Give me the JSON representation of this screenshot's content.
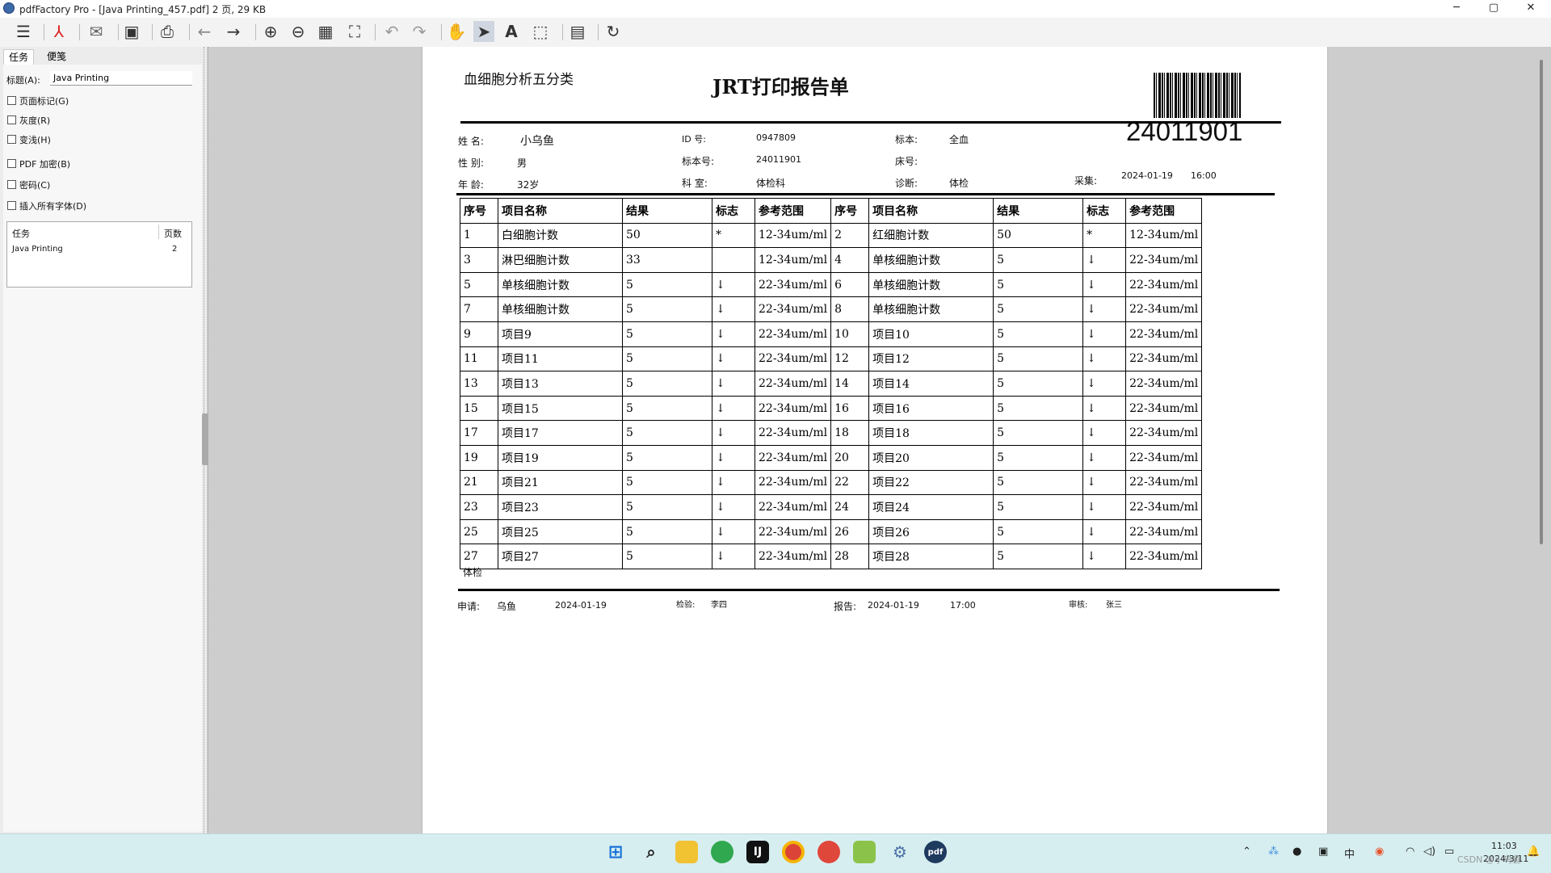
{
  "window": {
    "title": "pdfFactory Pro - [Java Printing_457.pdf] 2 页, 29 KB",
    "minimize": "─",
    "maximize": "▢",
    "close": "✕"
  },
  "toolbar": {
    "icons": [
      "menu-icon",
      "pdf-icon",
      "mail-icon",
      "save-icon",
      "print-icon",
      "back-arrow-icon",
      "forward-arrow-icon",
      "zoom-in-icon",
      "zoom-out-icon",
      "thumbnails-grid-icon",
      "fit-page-icon",
      "undo-icon",
      "redo-icon",
      "hand-tool-icon",
      "select-arrow-icon",
      "text-tool-icon",
      "marquee-select-icon",
      "notes-icon",
      "refresh-icon"
    ]
  },
  "side": {
    "tabs": [
      "任务",
      "便笺"
    ],
    "title_label": "标题(A):",
    "title_value": "Java Printing",
    "options": [
      "页面标记(G)",
      "灰度(R)",
      "变浅(H)",
      "PDF 加密(B)",
      "密码(C)",
      "插入所有字体(D)"
    ],
    "jobs_header": [
      "任务",
      "页数"
    ],
    "jobs": [
      {
        "name": "Java Printing",
        "pages": "2"
      }
    ]
  },
  "report": {
    "subtitle": "血细胞分析五分类",
    "title": "JRT打印报告单",
    "barcode_number": "24011901",
    "info": {
      "name_label": "姓 名:",
      "name": "小乌鱼",
      "id_label": "ID 号:",
      "id": "0947809",
      "specimen_label": "标本:",
      "specimen": "全血",
      "sex_label": "性 别:",
      "sex": "男",
      "specimen_no_label": "标本号:",
      "specimen_no": "24011901",
      "bed_label": "床号:",
      "age_label": "年 龄:",
      "age": "32岁",
      "dept_label": "科 室:",
      "dept": "体检科",
      "diag_label": "诊断:",
      "diag": "体检",
      "collect_label": "采集:",
      "collect_date": "2024-01-19",
      "collect_time": "16:00"
    },
    "table_header": [
      "序号",
      "项目名称",
      "结果",
      "标志",
      "参考范围",
      "序号",
      "项目名称",
      "结果",
      "标志",
      "参考范围"
    ],
    "rows": [
      [
        "1",
        "白细胞计数",
        "50",
        "*",
        "12-34um/ml",
        "2",
        "红细胞计数",
        "50",
        "*",
        "12-34um/ml"
      ],
      [
        "3",
        "淋巴细胞计数",
        "33",
        "",
        "12-34um/ml",
        "4",
        "单核细胞计数",
        "5",
        "↓",
        "22-34um/ml"
      ],
      [
        "5",
        "单核细胞计数",
        "5",
        "↓",
        "22-34um/ml",
        "6",
        "单核细胞计数",
        "5",
        "↓",
        "22-34um/ml"
      ],
      [
        "7",
        "单核细胞计数",
        "5",
        "↓",
        "22-34um/ml",
        "8",
        "单核细胞计数",
        "5",
        "↓",
        "22-34um/ml"
      ],
      [
        "9",
        "项目9",
        "5",
        "↓",
        "22-34um/ml",
        "10",
        "项目10",
        "5",
        "↓",
        "22-34um/ml"
      ],
      [
        "11",
        "项目11",
        "5",
        "↓",
        "22-34um/ml",
        "12",
        "项目12",
        "5",
        "↓",
        "22-34um/ml"
      ],
      [
        "13",
        "项目13",
        "5",
        "↓",
        "22-34um/ml",
        "14",
        "项目14",
        "5",
        "↓",
        "22-34um/ml"
      ],
      [
        "15",
        "项目15",
        "5",
        "↓",
        "22-34um/ml",
        "16",
        "项目16",
        "5",
        "↓",
        "22-34um/ml"
      ],
      [
        "17",
        "项目17",
        "5",
        "↓",
        "22-34um/ml",
        "18",
        "项目18",
        "5",
        "↓",
        "22-34um/ml"
      ],
      [
        "19",
        "项目19",
        "5",
        "↓",
        "22-34um/ml",
        "20",
        "项目20",
        "5",
        "↓",
        "22-34um/ml"
      ],
      [
        "21",
        "项目21",
        "5",
        "↓",
        "22-34um/ml",
        "22",
        "项目22",
        "5",
        "↓",
        "22-34um/ml"
      ],
      [
        "23",
        "项目23",
        "5",
        "↓",
        "22-34um/ml",
        "24",
        "项目24",
        "5",
        "↓",
        "22-34um/ml"
      ],
      [
        "25",
        "项目25",
        "5",
        "↓",
        "22-34um/ml",
        "26",
        "项目26",
        "5",
        "↓",
        "22-34um/ml"
      ],
      [
        "27",
        "项目27",
        "5",
        "↓",
        "22-34um/ml",
        "28",
        "项目28",
        "5",
        "↓",
        "22-34um/ml"
      ]
    ],
    "remark": "体检",
    "footer": {
      "apply_label": "申请:",
      "apply_name": "乌鱼",
      "apply_date": "2024-01-19",
      "test_label": "检验:",
      "tester": "李四",
      "report_label": "报告:",
      "report_date": "2024-01-19",
      "report_time": "17:00",
      "review_label": "审核:",
      "reviewer": "张三"
    }
  },
  "taskbar": {
    "icons": [
      "windows-start-icon",
      "search-icon",
      "file-explorer-icon",
      "edge-browser-icon",
      "jetbrains-icon",
      "chrome-icon",
      "app-red-icon",
      "app-green-icon",
      "app-network-icon",
      "pdffactory-icon"
    ],
    "tray_icons": [
      "chevron-up-icon",
      "network-cluster-icon",
      "qq-icon",
      "display-icon",
      "ime-icon",
      "app-orange-icon",
      "wifi-icon",
      "volume-icon",
      "battery-icon",
      "notification-icon"
    ],
    "ime_text": "中",
    "time": "11:03",
    "date": "2024/3/11",
    "watermark": "CSDN @小乌鱼"
  }
}
